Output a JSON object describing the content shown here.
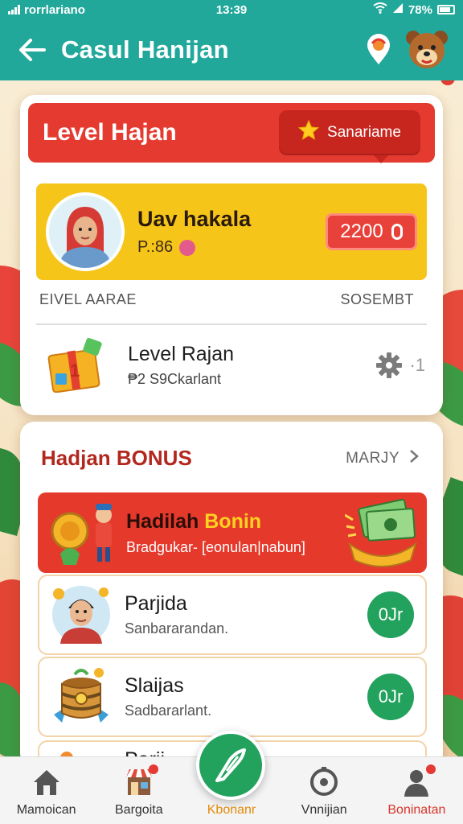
{
  "status_bar": {
    "carrier": "rorrlariano",
    "time": "13:39",
    "battery": "78%"
  },
  "header": {
    "title": "Casul Hanijan",
    "back_icon": "arrow-left-icon",
    "location_icon": "location-pin-icon",
    "mascot_icon": "bear-mascot-icon"
  },
  "level_card": {
    "title": "Level Hajan",
    "badge_label": "Sanariame",
    "user_name": "Uav hakala",
    "user_sub": "P.:86",
    "score": "2200",
    "label_left": "EIVEL AARAE",
    "label_right": "SOSEMBT",
    "level_title": "Level Rajan",
    "level_sub": "₱2 S9Ckarlant",
    "level_count": "·1"
  },
  "bonus_card": {
    "title": "Hadjan BONUS",
    "more_label": "MARJY",
    "banner_title_a": "Hadilah",
    "banner_title_b": "Bonin",
    "banner_sub": "Bradgukar- [eonulan|nabun]",
    "items": [
      {
        "title": "Parjida",
        "sub": "Sanbararandan.",
        "button": "0Jr"
      },
      {
        "title": "Slaijas",
        "sub": "Sadbararlant.",
        "button": "0Jr"
      },
      {
        "title": "Parji",
        "sub": "",
        "button": ""
      }
    ]
  },
  "bottom_nav": [
    {
      "label": "Mamoican",
      "icon": "home-icon"
    },
    {
      "label": "Bargoita",
      "icon": "shop-icon"
    },
    {
      "label": "Kbonanr",
      "icon": "feather-icon"
    },
    {
      "label": "Vnnijian",
      "icon": "clock-icon"
    },
    {
      "label": "Boninatan",
      "icon": "user-icon"
    }
  ],
  "colors": {
    "teal": "#21a89b",
    "red": "#e53a2f",
    "yellow": "#f6c519",
    "green": "#22a25d"
  }
}
